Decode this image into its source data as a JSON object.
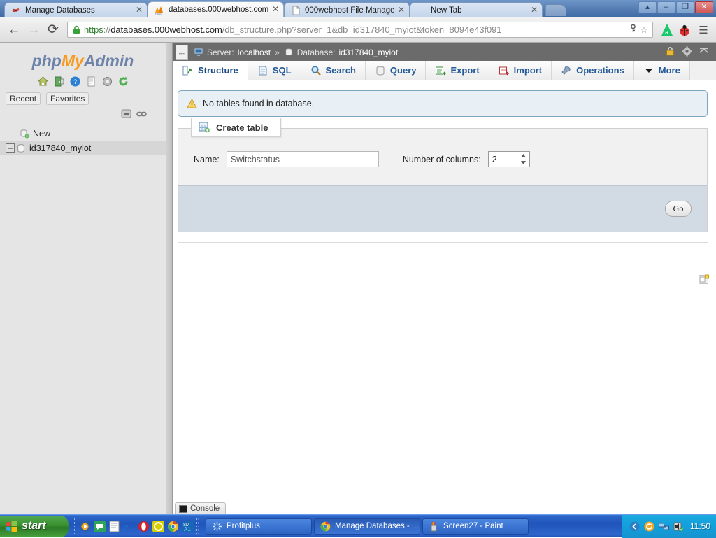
{
  "browser": {
    "tabs": [
      {
        "title": "Manage Databases",
        "favicon": "pinwheel-icon",
        "active": false
      },
      {
        "title": "databases.000webhost.com",
        "favicon": "phpmyadmin-icon",
        "active": true
      },
      {
        "title": "000webhost File Manager",
        "favicon": "page-icon",
        "active": false
      },
      {
        "title": "New Tab",
        "favicon": "blank-icon",
        "active": false
      }
    ],
    "close_label": "✕",
    "caption": {
      "user": "▴",
      "minimize": "–",
      "maximize": "❐",
      "close": "✕"
    },
    "nav": {
      "back": "←",
      "forward": "→",
      "reload": "⟳"
    },
    "omnibox": {
      "scheme": "https",
      "separator": "://",
      "host": "databases.000webhost.com",
      "path": "/db_structure.php?server=1&db=id317840_myiot&token=8094e43f091",
      "key_icon": "key-icon",
      "star_icon": "☆"
    },
    "extensions": [
      "avast-icon",
      "ladybug-icon"
    ],
    "menu_icon": "☰"
  },
  "sidebar": {
    "logo": {
      "php": "php",
      "my": "My",
      "admin": "Admin"
    },
    "icons": [
      "home-icon",
      "logout-icon",
      "help-icon",
      "docs-icon",
      "settings-icon",
      "reload-icon"
    ],
    "recent_label": "Recent",
    "favorites_label": "Favorites",
    "tree_controls": [
      "collapse-all-icon",
      "link-with-main-icon"
    ],
    "tree": [
      {
        "label": "New",
        "icon": "new-db-icon",
        "selected": false
      },
      {
        "label": "id317840_myiot",
        "icon": "database-icon",
        "selected": true
      }
    ]
  },
  "main": {
    "breadcrumb": {
      "server_label": "Server:",
      "server_value": "localhost",
      "separator": "»",
      "db_label": "Database:",
      "db_value": "id317840_myiot"
    },
    "server_bar_icons": [
      "lock-icon",
      "gear-icon",
      "collapse-icon"
    ],
    "back_arrow": "←",
    "tabs": [
      {
        "label": "Structure",
        "icon": "structure-icon",
        "active": true
      },
      {
        "label": "SQL",
        "icon": "sql-icon",
        "active": false
      },
      {
        "label": "Search",
        "icon": "search-icon",
        "active": false
      },
      {
        "label": "Query",
        "icon": "query-icon",
        "active": false
      },
      {
        "label": "Export",
        "icon": "export-icon",
        "active": false
      },
      {
        "label": "Import",
        "icon": "import-icon",
        "active": false
      },
      {
        "label": "Operations",
        "icon": "operations-icon",
        "active": false
      },
      {
        "label": "More",
        "icon": "chevron-down-icon",
        "active": false
      }
    ],
    "notice": {
      "text": "No tables found in database.",
      "icon": "warning-icon"
    },
    "create_table": {
      "legend": "Create table",
      "legend_icon": "create-table-icon",
      "name_label": "Name:",
      "name_value": "Switchstatus",
      "columns_label": "Number of columns:",
      "columns_value": "2",
      "go_label": "Go"
    },
    "console": {
      "label": "Console",
      "icon": "console-icon"
    }
  },
  "taskbar": {
    "start_label": "start",
    "quick_launch": [
      "media-player-icon",
      "messenger-icon",
      "notepad-icon",
      "internet-explorer-icon",
      "opera-icon",
      "whatsapp-icon",
      "chrome-icon",
      "sm-icon"
    ],
    "tasks": [
      {
        "label": "Profitplus",
        "icon": "profitplus-icon",
        "active": false
      },
      {
        "label": "Manage Databases - ...",
        "icon": "chrome-icon",
        "active": true
      },
      {
        "label": "Screen27 - Paint",
        "icon": "paint-icon",
        "active": false
      }
    ],
    "tray": [
      "show-hidden-icon",
      "update-icon",
      "network-icon",
      "volume-icon"
    ],
    "clock": "11:50"
  }
}
